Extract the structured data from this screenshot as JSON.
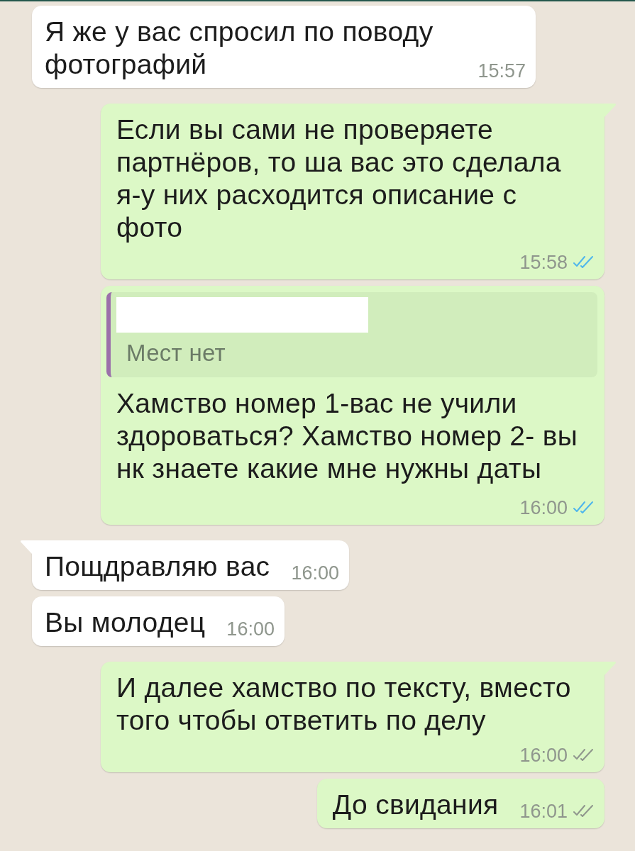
{
  "messages": [
    {
      "outgoing": false,
      "tail": false,
      "text": "Я же у вас спросил по поводу фотографий",
      "time": "15:57"
    },
    {
      "outgoing": true,
      "tail": true,
      "text": "Если вы сами не проверяете партнёров, то ша вас это сделала я-у них расходится описание с фото",
      "time": "15:58",
      "read": true
    },
    {
      "outgoing": true,
      "tail": false,
      "quote": {
        "name_hidden": true,
        "text": "Мест нет"
      },
      "text": "Хамство номер 1-вас не учили здороваться? Хамство номер 2- вы нк знаете какие мне нужны даты",
      "time": "16:00",
      "read": true
    },
    {
      "outgoing": false,
      "tail": true,
      "text": "Пощдравляю вас",
      "time": "16:00"
    },
    {
      "outgoing": false,
      "tail": false,
      "text": "Вы молодец",
      "time": "16:00"
    },
    {
      "outgoing": true,
      "tail": true,
      "text": "И далее хамство по тексту, вместо того чтобы ответить по делу",
      "time": "16:00",
      "read": false
    },
    {
      "outgoing": true,
      "tail": false,
      "text": "До свидания",
      "time": "16:01",
      "read": false
    }
  ]
}
